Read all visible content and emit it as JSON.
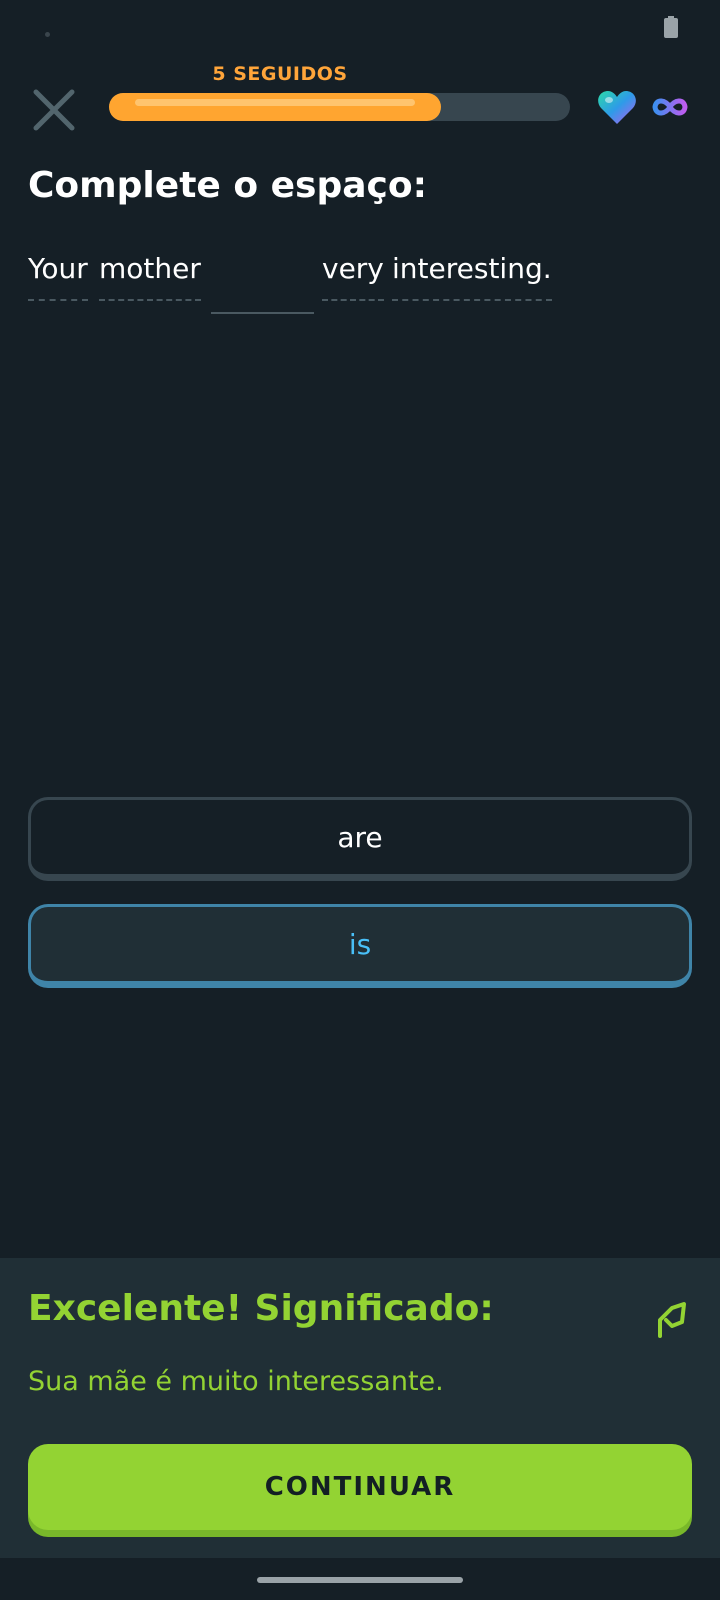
{
  "status_bar": {
    "battery_icon": "battery-icon"
  },
  "top_bar": {
    "close_icon": "close-icon",
    "streak_label": "5 SEGUIDOS",
    "progress_fraction": 0.72,
    "hearts_icon": "heart-icon",
    "infinity_icon": "infinity-icon"
  },
  "exercise": {
    "prompt": "Complete o espaço:",
    "sentence": {
      "before": [
        "Your",
        "mother"
      ],
      "after": [
        "very",
        "interesting."
      ]
    },
    "choices": [
      {
        "label": "are",
        "selected": false
      },
      {
        "label": "is",
        "selected": true
      }
    ]
  },
  "feedback": {
    "title": "Excelente! Significado:",
    "meaning": "Sua mãe é muito interessante.",
    "continue_label": "CONTINUAR",
    "report_icon": "flag-icon"
  },
  "colors": {
    "background": "#151f26",
    "streak_orange": "#ffa530",
    "success_green": "#93d333",
    "selected_blue": "#49c0f8"
  }
}
